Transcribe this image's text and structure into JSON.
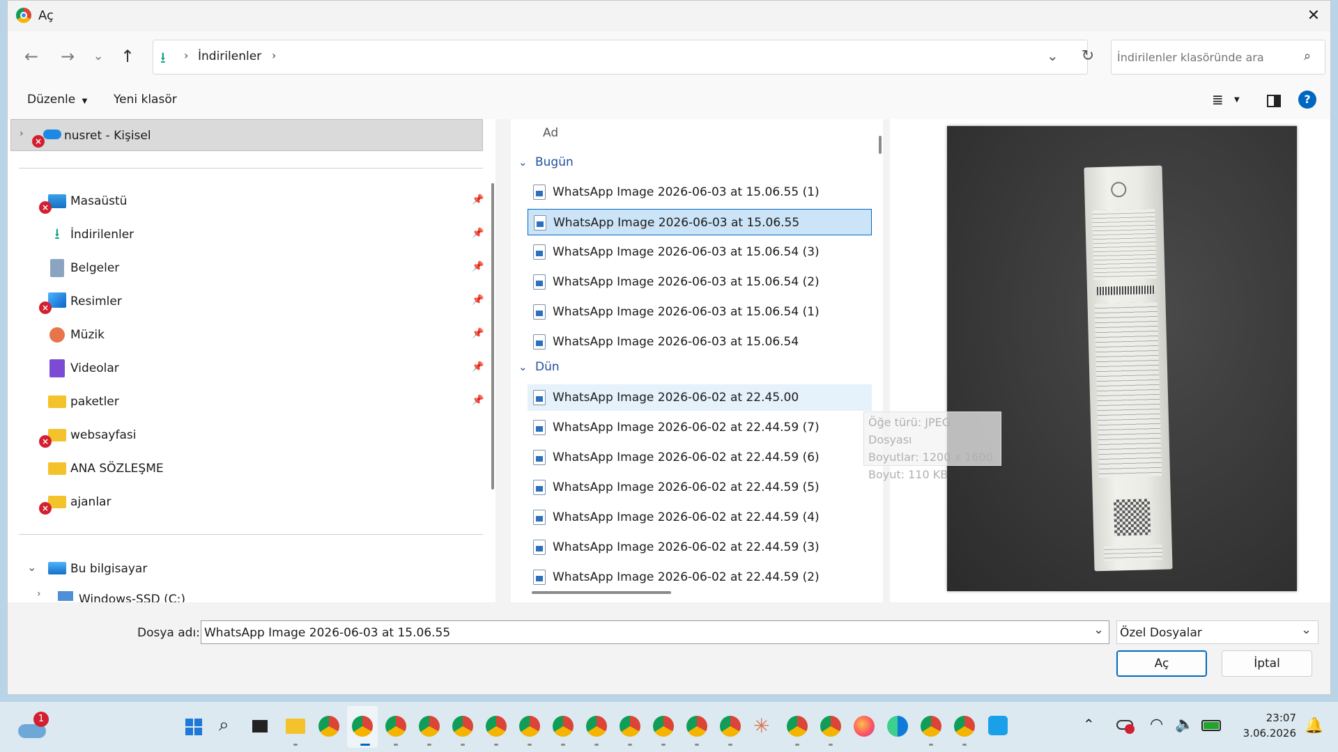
{
  "window": {
    "title": "Aç"
  },
  "address": {
    "crumbs": [
      "İndirilenler"
    ]
  },
  "search": {
    "placeholder": "İndirilenler klasöründe ara"
  },
  "toolbar": {
    "organize_label": "Düzenle",
    "new_folder_label": "Yeni klasör"
  },
  "sidebar": {
    "cloud_item": "nusret - Kişisel",
    "quick_items": [
      {
        "label": "Masaüstü",
        "icon": "desktop-icon",
        "error": true
      },
      {
        "label": "İndirilenler",
        "icon": "download-icon",
        "error": false
      },
      {
        "label": "Belgeler",
        "icon": "documents-icon",
        "error": false
      },
      {
        "label": "Resimler",
        "icon": "pictures-icon",
        "error": true
      },
      {
        "label": "Müzik",
        "icon": "music-icon",
        "error": false
      },
      {
        "label": "Videolar",
        "icon": "videos-icon",
        "error": false
      },
      {
        "label": "paketler",
        "icon": "folder-icon",
        "error": false
      },
      {
        "label": "websayfasi",
        "icon": "folder-icon",
        "error": true
      },
      {
        "label": "ANA SÖZLEŞME",
        "icon": "folder-icon",
        "error": false
      },
      {
        "label": "ajanlar",
        "icon": "folder-icon",
        "error": true
      }
    ],
    "this_pc": "Bu bilgisayar",
    "drive": "Windows-SSD (C:)"
  },
  "filelist": {
    "column_name": "Ad",
    "groups": [
      {
        "label": "Bugün",
        "files": [
          "WhatsApp Image 2026-06-03 at 15.06.55 (1)",
          "WhatsApp Image 2026-06-03 at 15.06.55",
          "WhatsApp Image 2026-06-03 at 15.06.54 (3)",
          "WhatsApp Image 2026-06-03 at 15.06.54 (2)",
          "WhatsApp Image 2026-06-03 at 15.06.54 (1)",
          "WhatsApp Image 2026-06-03 at 15.06.54"
        ]
      },
      {
        "label": "Dün",
        "files": [
          "WhatsApp Image 2026-06-02 at 22.45.00",
          "WhatsApp Image 2026-06-02 at 22.44.59 (7)",
          "WhatsApp Image 2026-06-02 at 22.44.59 (6)",
          "WhatsApp Image 2026-06-02 at 22.44.59 (5)",
          "WhatsApp Image 2026-06-02 at 22.44.59 (4)",
          "WhatsApp Image 2026-06-02 at 22.44.59 (3)",
          "WhatsApp Image 2026-06-02 at 22.44.59 (2)"
        ]
      }
    ]
  },
  "tooltip": {
    "type": "Öğe türü: JPEG Dosyası",
    "dims": "Boyutlar: 1200 x 1600",
    "size": "Boyut: 110 KB"
  },
  "footer": {
    "filename_label": "Dosya adı:",
    "filename_value": "WhatsApp Image 2026-06-03 at 15.06.55",
    "filetype_value": "Özel Dosyalar",
    "open_label": "Aç",
    "cancel_label": "İptal"
  },
  "taskbar": {
    "notification_count": "1",
    "time": "23:07",
    "date": "3.06.2026"
  },
  "colors": {
    "accent": "#0067c0",
    "selection": "#cce4f7",
    "error": "#d32030",
    "folder": "#f4c22b"
  }
}
